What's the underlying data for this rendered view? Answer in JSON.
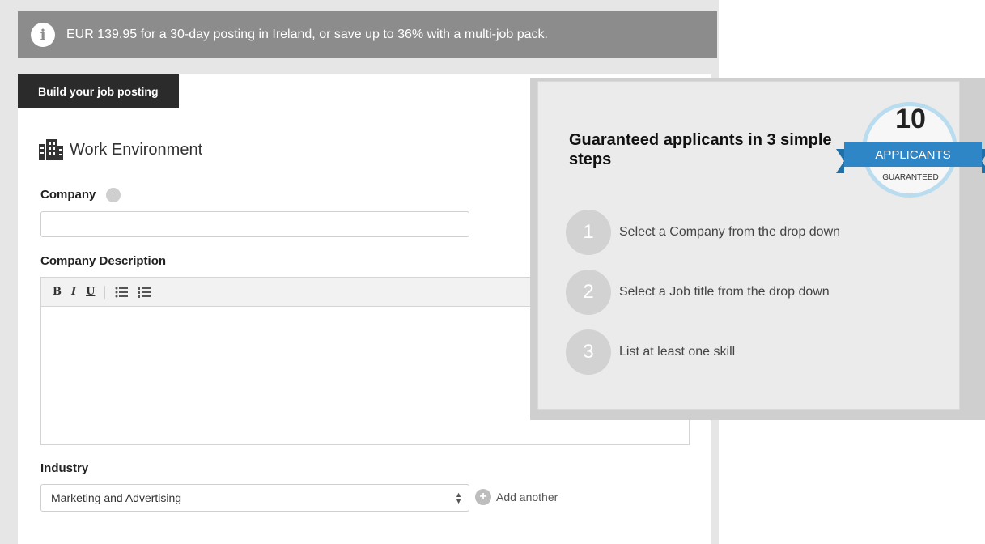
{
  "banner": {
    "icon": "info-icon",
    "text": "EUR 139.95 for a 30-day posting in Ireland, or save up to 36% with a multi-job pack."
  },
  "form": {
    "tab_label": "Build your job posting",
    "section_title": "Work Environment",
    "company_label": "Company",
    "company_help": "i",
    "company_value": "",
    "description_label": "Company Description",
    "toolbar": {
      "bold": "B",
      "italic": "I",
      "underline": "U"
    },
    "industry_label": "Industry",
    "industry_value": "Marketing and Advertising",
    "add_another": "Add another"
  },
  "overlay": {
    "title": "Guaranteed applicants in 3 simple steps",
    "badge": {
      "number": "10",
      "ribbon": "APPLICANTS",
      "sub": "GUARANTEED"
    },
    "steps": [
      {
        "num": "1",
        "text": "Select a Company from the drop down"
      },
      {
        "num": "2",
        "text": "Select a Job title from the drop down"
      },
      {
        "num": "3",
        "text": "List at least one skill"
      }
    ]
  },
  "colors": {
    "banner_bg": "#8c8c8c",
    "tab_bg": "#2b2b2b",
    "ribbon_blue": "#2e86c7",
    "badge_ring": "#b9dcef"
  }
}
